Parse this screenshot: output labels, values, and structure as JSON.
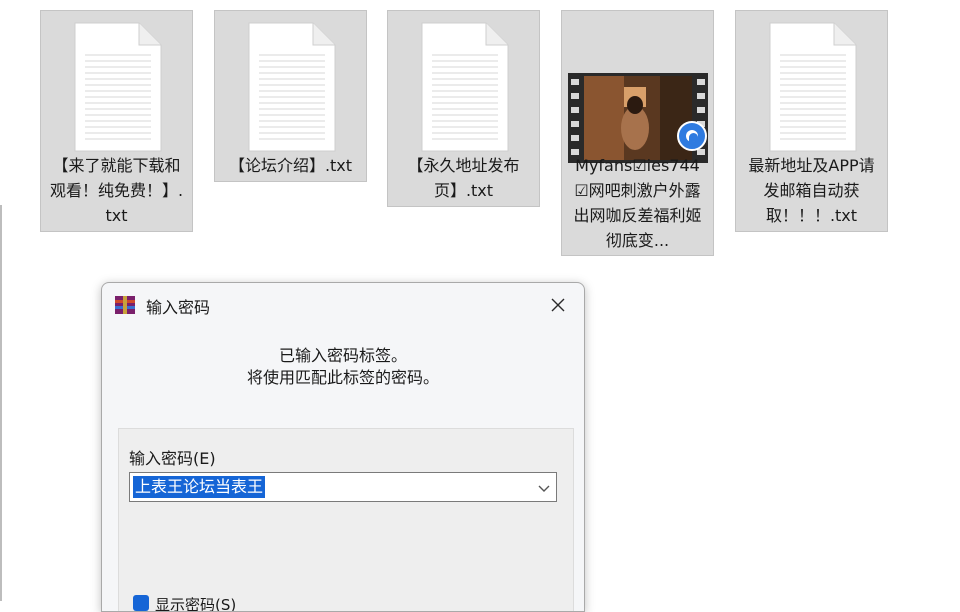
{
  "files": [
    {
      "name": "【来了就能下载和观看！纯免费！】.txt",
      "type": "text",
      "icon": "text-file-icon"
    },
    {
      "name": "【论坛介绍】.txt",
      "type": "text",
      "icon": "text-file-icon"
    },
    {
      "name": "【永久地址发布页】.txt",
      "type": "text",
      "icon": "text-file-icon"
    },
    {
      "name": "Myfans☑ies744☑网吧刺激户外露出网咖反差福利姬彻底变...",
      "type": "video",
      "icon": "video-thumbnail"
    },
    {
      "name": "最新地址及APP请发邮箱自动获取！！！.txt",
      "type": "text",
      "icon": "text-file-icon"
    }
  ],
  "dialog": {
    "title": "输入密码",
    "message_line1": "已输入密码标签。",
    "message_line2": "将使用匹配此标签的密码。",
    "password_label": "输入密码(E)",
    "password_value": "上表王论坛当表王",
    "show_password_label": "显示密码(S)"
  },
  "colors": {
    "tile_bg": "#dadada",
    "selection": "#1565d6",
    "badge": "#2f7be0"
  }
}
